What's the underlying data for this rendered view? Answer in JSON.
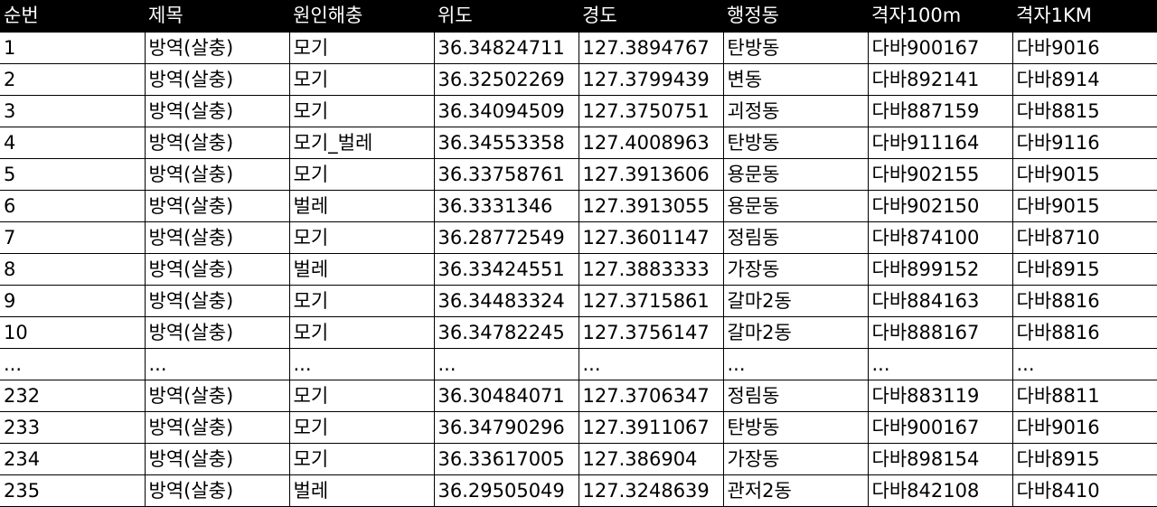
{
  "table": {
    "headers": [
      "순번",
      "제목",
      "원인해충",
      "위도",
      "경도",
      "행정동",
      "격자100m",
      "격자1KM"
    ],
    "rows": [
      [
        "1",
        "방역(살충)",
        "모기",
        "36.34824711",
        "127.3894767",
        "탄방동",
        "다바900167",
        "다바9016"
      ],
      [
        "2",
        "방역(살충)",
        "모기",
        "36.32502269",
        "127.3799439",
        "변동",
        "다바892141",
        "다바8914"
      ],
      [
        "3",
        "방역(살충)",
        "모기",
        "36.34094509",
        "127.3750751",
        "괴정동",
        "다바887159",
        "다바8815"
      ],
      [
        "4",
        "방역(살충)",
        "모기_벌레",
        "36.34553358",
        "127.4008963",
        "탄방동",
        "다바911164",
        "다바9116"
      ],
      [
        "5",
        "방역(살충)",
        "모기",
        "36.33758761",
        "127.3913606",
        "용문동",
        "다바902155",
        "다바9015"
      ],
      [
        "6",
        "방역(살충)",
        "벌레",
        "36.3331346",
        "127.3913055",
        "용문동",
        "다바902150",
        "다바9015"
      ],
      [
        "7",
        "방역(살충)",
        "모기",
        "36.28772549",
        "127.3601147",
        "정림동",
        "다바874100",
        "다바8710"
      ],
      [
        "8",
        "방역(살충)",
        "벌레",
        "36.33424551",
        "127.3883333",
        "가장동",
        "다바899152",
        "다바8915"
      ],
      [
        "9",
        "방역(살충)",
        "모기",
        "36.34483324",
        "127.3715861",
        "갈마2동",
        "다바884163",
        "다바8816"
      ],
      [
        "10",
        "방역(살충)",
        "모기",
        "36.34782245",
        "127.3756147",
        "갈마2동",
        "다바888167",
        "다바8816"
      ],
      [
        "...",
        "...",
        "...",
        "...",
        "...",
        "...",
        "...",
        "..."
      ],
      [
        "232",
        "방역(살충)",
        "모기",
        "36.30484071",
        "127.3706347",
        "정림동",
        "다바883119",
        "다바8811"
      ],
      [
        "233",
        "방역(살충)",
        "모기",
        "36.34790296",
        "127.3911067",
        "탄방동",
        "다바900167",
        "다바9016"
      ],
      [
        "234",
        "방역(살충)",
        "모기",
        "36.33617005",
        "127.386904",
        "가장동",
        "다바898154",
        "다바8915"
      ],
      [
        "235",
        "방역(살충)",
        "벌레",
        "36.29505049",
        "127.3248639",
        "관저2동",
        "다바842108",
        "다바8410"
      ]
    ]
  }
}
